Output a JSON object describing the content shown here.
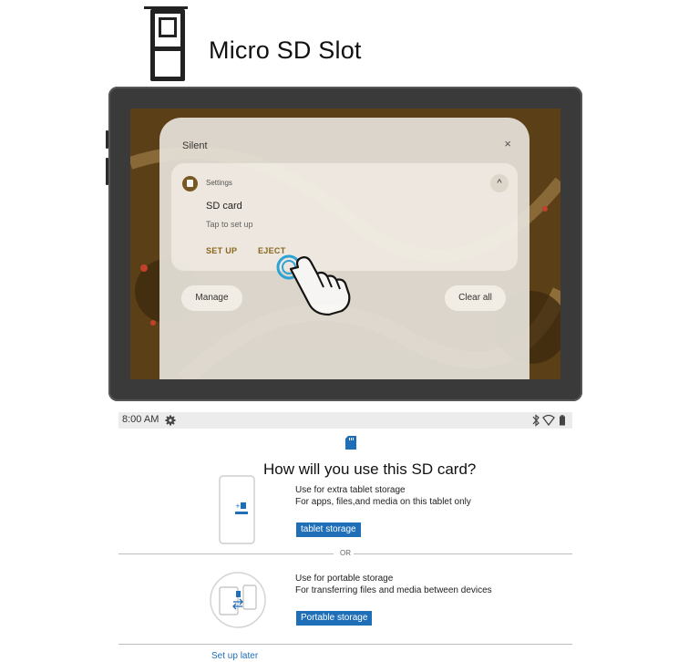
{
  "header": {
    "title": "Micro SD Slot"
  },
  "notification_shade": {
    "section_label": "Silent",
    "close_glyph": "×",
    "card": {
      "app_name": "Settings",
      "expand_glyph": "^",
      "title": "SD card",
      "text": "Tap to set up",
      "actions": {
        "setup": "SET UP",
        "eject": "EJECT"
      }
    },
    "manage_label": "Manage",
    "clear_all_label": "Clear all"
  },
  "status_bar": {
    "time": "8:00 AM"
  },
  "setup_page": {
    "title": "How will you use this SD card?",
    "option_internal": {
      "title": "Use for extra tablet storage",
      "description": "For apps, files,and media on this tablet only",
      "button": "tablet storage"
    },
    "or_label": "OR",
    "option_portable": {
      "title": "Use for portable storage",
      "description": "For transferring files and media between devices",
      "button": "Portable storage"
    },
    "setup_later": "Set up later"
  },
  "colors": {
    "accent_blue": "#1e6eb8",
    "notification_action": "#8a6a1e",
    "tap_ring": "#2aa8e0"
  },
  "icons": [
    "sd-tray-icon",
    "close-icon",
    "settings-app-icon",
    "chevron-up-icon",
    "hand-pointer-icon",
    "gear-icon",
    "bluetooth-icon",
    "wifi-icon",
    "battery-icon",
    "sd-card-icon"
  ]
}
